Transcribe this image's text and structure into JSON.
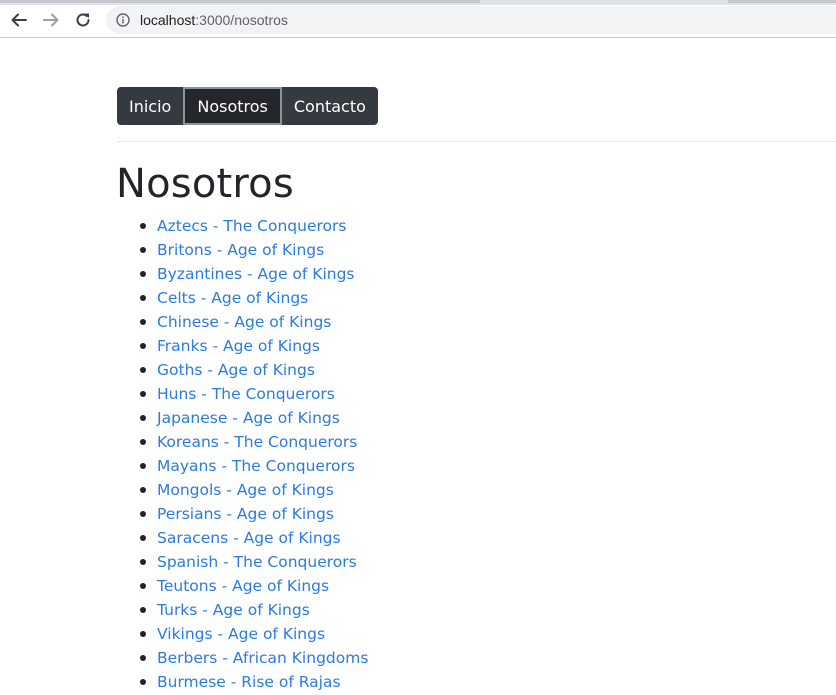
{
  "browser": {
    "url_host": "localhost",
    "url_path": ":3000/nosotros"
  },
  "navbar": {
    "items": [
      {
        "label": "Inicio",
        "active": false
      },
      {
        "label": "Nosotros",
        "active": true
      },
      {
        "label": "Contacto",
        "active": false
      }
    ]
  },
  "page": {
    "title": "Nosotros"
  },
  "civilizations": [
    "Aztecs - The Conquerors",
    "Britons - Age of Kings",
    "Byzantines - Age of Kings",
    "Celts - Age of Kings",
    "Chinese - Age of Kings",
    "Franks - Age of Kings",
    "Goths - Age of Kings",
    "Huns - The Conquerors",
    "Japanese - Age of Kings",
    "Koreans - The Conquerors",
    "Mayans - The Conquerors",
    "Mongols - Age of Kings",
    "Persians - Age of Kings",
    "Saracens - Age of Kings",
    "Spanish - The Conquerors",
    "Teutons - Age of Kings",
    "Turks - Age of Kings",
    "Vikings - Age of Kings",
    "Berbers - African Kingdoms",
    "Burmese - Rise of Rajas"
  ],
  "colors": {
    "navbar_bg": "#343a40",
    "link": "#2a7be4",
    "text": "#212529"
  }
}
